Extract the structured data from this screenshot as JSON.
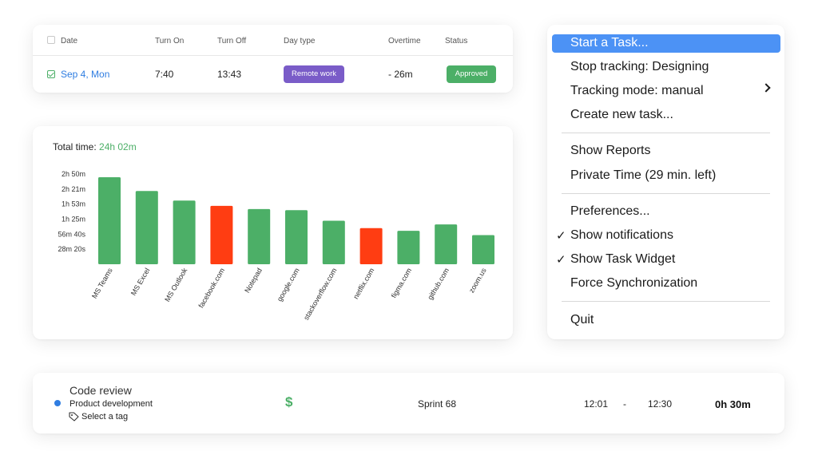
{
  "timesheet": {
    "headers": {
      "date": "Date",
      "turn_on": "Turn On",
      "turn_off": "Turn Off",
      "day_type": "Day type",
      "overtime": "Overtime",
      "status": "Status"
    },
    "row": {
      "checked": true,
      "date": "Sep 4, Mon",
      "turn_on": "7:40",
      "turn_off": "13:43",
      "day_type": "Remote work",
      "overtime": "- 26m",
      "status": "Approved"
    },
    "colors": {
      "date_link": "#2f7de1",
      "day_type_badge": "#7a5cc8",
      "status_badge": "#4caf67"
    }
  },
  "chart_card": {
    "total_label": "Total time:",
    "total_value": "24h 02m"
  },
  "chart_data": {
    "type": "bar",
    "categories": [
      "MS Teams",
      "MS Excel",
      "MS Outlook",
      "facebook.com",
      "Notepad",
      "google.com",
      "stackoverflow.com",
      "netflix.com",
      "figma.com",
      "github.com",
      "zoom.us"
    ],
    "values": [
      164,
      138,
      120,
      110,
      104,
      102,
      82,
      68,
      63,
      75,
      55
    ],
    "value_unit": "minutes",
    "categories_flagged": [
      "facebook.com",
      "netflix.com"
    ],
    "colors": {
      "productive": "#4caf67",
      "unproductive": "#ff3d12"
    },
    "y_ticks": [
      "28m 20s",
      "56m 40s",
      "1h 25m",
      "1h 53m",
      "2h 21m",
      "2h 50m"
    ],
    "y_tick_values": [
      28.33,
      56.67,
      85,
      113.33,
      141.67,
      170
    ],
    "ylim": [
      0,
      170
    ],
    "title": "",
    "xlabel": "",
    "ylabel": "",
    "grid": false
  },
  "menu": {
    "items": [
      {
        "label": "Start a Task...",
        "highlighted": true
      },
      {
        "label": "Stop tracking: Designing"
      },
      {
        "label": "Tracking mode: manual",
        "submenu": true
      },
      {
        "label": "Create new task..."
      },
      {
        "label": "Show Reports"
      },
      {
        "label": "Private Time (29 min. left)"
      },
      {
        "label": "Preferences..."
      },
      {
        "label": "Show notifications",
        "checked": true
      },
      {
        "label": "Show Task Widget",
        "checked": true
      },
      {
        "label": "Force Synchronization"
      },
      {
        "label": "Quit"
      }
    ],
    "check_glyph": "✓",
    "highlight_color": "#4c92f5"
  },
  "task": {
    "title": "Code review",
    "project": "Product development",
    "tag_placeholder": "Select a tag",
    "billable_symbol": "$",
    "sprint": "Sprint 68",
    "start": "12:01",
    "separator": "-",
    "end": "12:30",
    "duration": "0h 30m",
    "dot_color": "#2f7de1"
  }
}
